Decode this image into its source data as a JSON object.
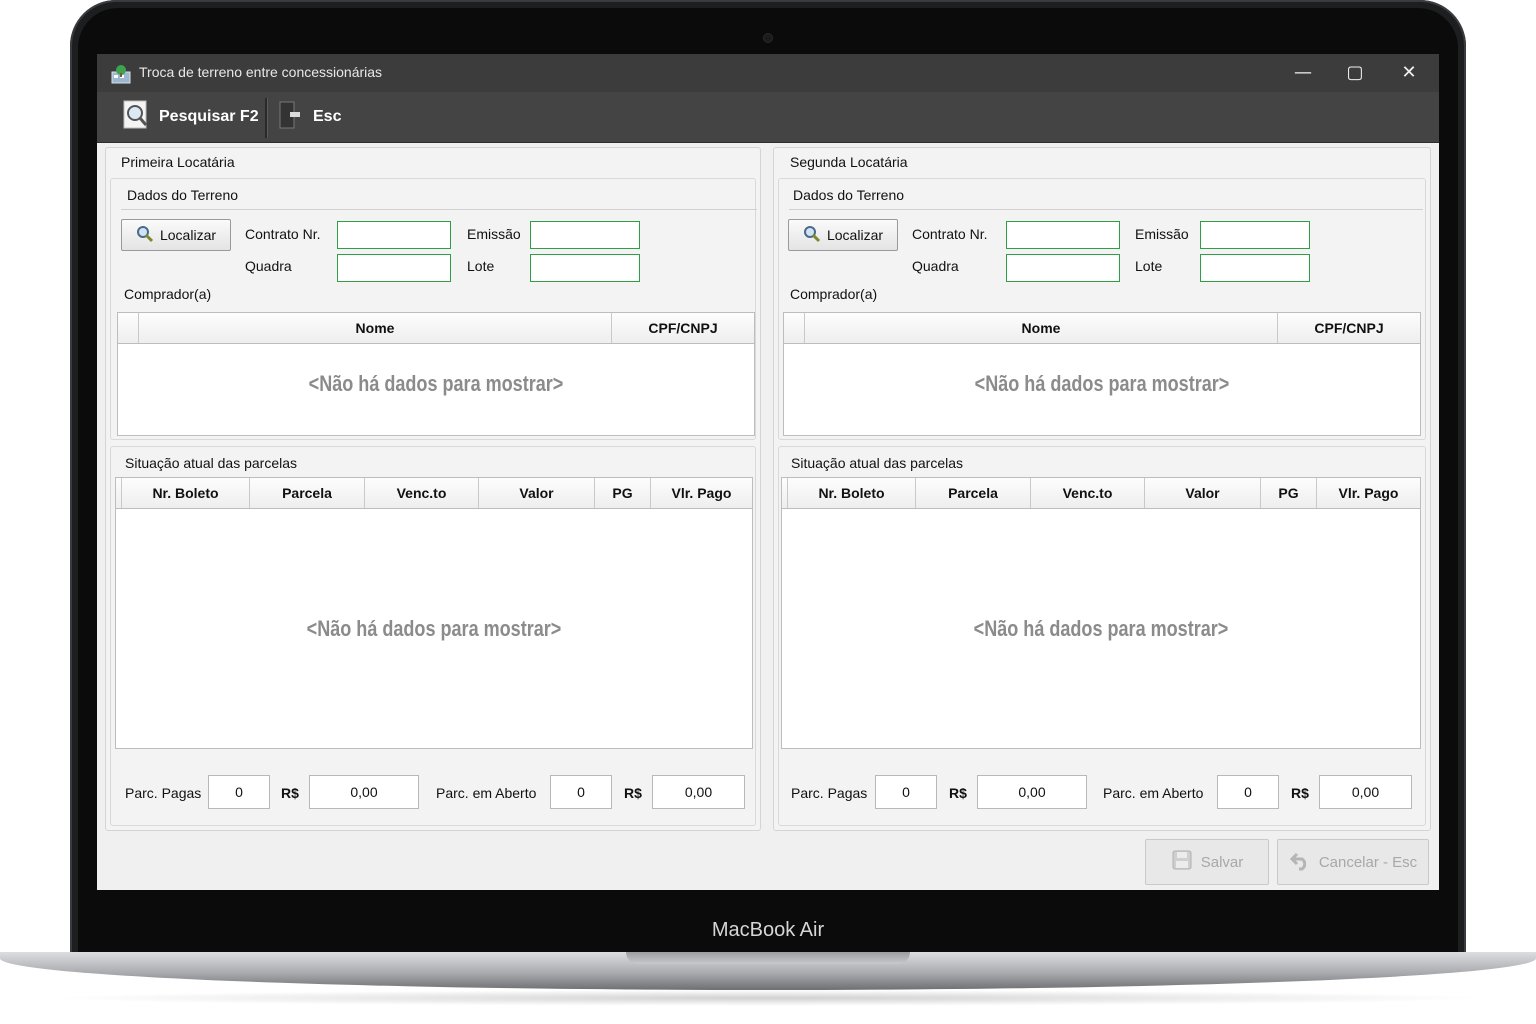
{
  "device": {
    "label": "MacBook Air"
  },
  "window": {
    "title": "Troca de terreno entre concessionárias",
    "controls": {
      "minimize": "—",
      "maximize": "▢",
      "close": "✕"
    }
  },
  "toolbar": {
    "search_label": "Pesquisar F2",
    "esc_label": "Esc"
  },
  "panels": [
    {
      "title": "Primeira Locatária",
      "terreno": {
        "title": "Dados do Terreno",
        "locate_label": "Localizar",
        "contrato_label": "Contrato Nr.",
        "contrato_value": "",
        "emissao_label": "Emissão",
        "emissao_value": "",
        "quadra_label": "Quadra",
        "quadra_value": "",
        "lote_label": "Lote",
        "lote_value": "",
        "comprador_label": "Comprador(a)",
        "columns": [
          "Nome",
          "CPF/CNPJ"
        ],
        "empty_text": "<Não há dados para mostrar>"
      },
      "parcelas": {
        "title": "Situação atual das parcelas",
        "columns": [
          "Nr. Boleto",
          "Parcela",
          "Venc.to",
          "Valor",
          "PG",
          "Vlr. Pago"
        ],
        "empty_text": "<Não há dados para mostrar>",
        "pagas_label": "Parc. Pagas",
        "pagas_count": "0",
        "currency": "R$",
        "pagas_value": "0,00",
        "aberto_label": "Parc. em Aberto",
        "aberto_count": "0",
        "aberto_value": "0,00"
      }
    },
    {
      "title": "Segunda Locatária",
      "terreno": {
        "title": "Dados do Terreno",
        "locate_label": "Localizar",
        "contrato_label": "Contrato Nr.",
        "contrato_value": "",
        "emissao_label": "Emissão",
        "emissao_value": "",
        "quadra_label": "Quadra",
        "quadra_value": "",
        "lote_label": "Lote",
        "lote_value": "",
        "comprador_label": "Comprador(a)",
        "columns": [
          "Nome",
          "CPF/CNPJ"
        ],
        "empty_text": "<Não há dados para mostrar>"
      },
      "parcelas": {
        "title": "Situação atual das parcelas",
        "columns": [
          "Nr. Boleto",
          "Parcela",
          "Venc.to",
          "Valor",
          "PG",
          "Vlr. Pago"
        ],
        "empty_text": "<Não há dados para mostrar>",
        "pagas_label": "Parc. Pagas",
        "pagas_count": "0",
        "currency": "R$",
        "pagas_value": "0,00",
        "aberto_label": "Parc. em Aberto",
        "aberto_count": "0",
        "aberto_value": "0,00"
      }
    }
  ],
  "footer": {
    "save_label": "Salvar",
    "cancel_label": "Cancelar - Esc"
  },
  "colors": {
    "titlebar": "#3c3c3c",
    "toolbar": "#444444",
    "field_border": "#2f9e44",
    "empty_text": "#8b8b8b"
  }
}
